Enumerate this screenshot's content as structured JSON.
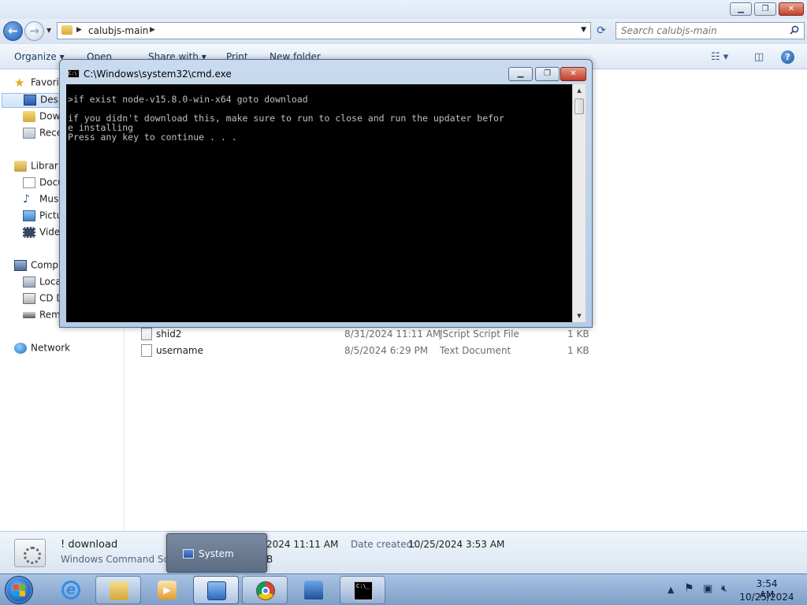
{
  "explorer": {
    "search_placeholder": "Search calubjs-main",
    "breadcrumb": "calubjs-main",
    "toolbar": {
      "organize": "Organize",
      "open": "Open",
      "share_with": "Share with",
      "print": "Print",
      "new_folder": "New folder"
    },
    "nav": {
      "favorites": "Favorit",
      "desktop": "Desk",
      "downloads": "Dow",
      "recent": "Rece",
      "libraries": "Librari",
      "documents": "Docu",
      "music": "Mus",
      "pictures": "Pictu",
      "videos": "Vide",
      "computer": "Comp",
      "local_disk": "Loca",
      "cd_drive": "CD D",
      "removable": "Rem",
      "network": "Network"
    },
    "files": [
      {
        "name": "shid2",
        "date": "8/31/2024 11:11 AM",
        "type": "JScript Script File",
        "size": "1 KB"
      },
      {
        "name": "username",
        "date": "8/5/2024 6:29 PM",
        "type": "Text Document",
        "size": "1 KB"
      }
    ],
    "details": {
      "name": "! download",
      "type": "Windows Command Scrip",
      "modified": "2024 11:11 AM",
      "size": "B",
      "created_label": "Date created:",
      "created_value": "10/25/2024 3:53 AM"
    }
  },
  "cmd": {
    "title": "C:\\Windows\\system32\\cmd.exe",
    "icon_text": "C:\\",
    "lines": [
      ">if exist node-v15.8.0-win-x64 goto download",
      "",
      "if you didn't download this, make sure to run to close and run the updater befor",
      "e installing",
      "Press any key to continue . . ."
    ]
  },
  "popup": {
    "label": "System"
  },
  "taskbar": {
    "time": "3:54 AM",
    "date": "10/25/2024"
  },
  "colors": {
    "console_bg": "#000000",
    "console_text": "#c0c0c0",
    "taskbar": "#7e9fc9",
    "close_red": "#c4402a"
  }
}
